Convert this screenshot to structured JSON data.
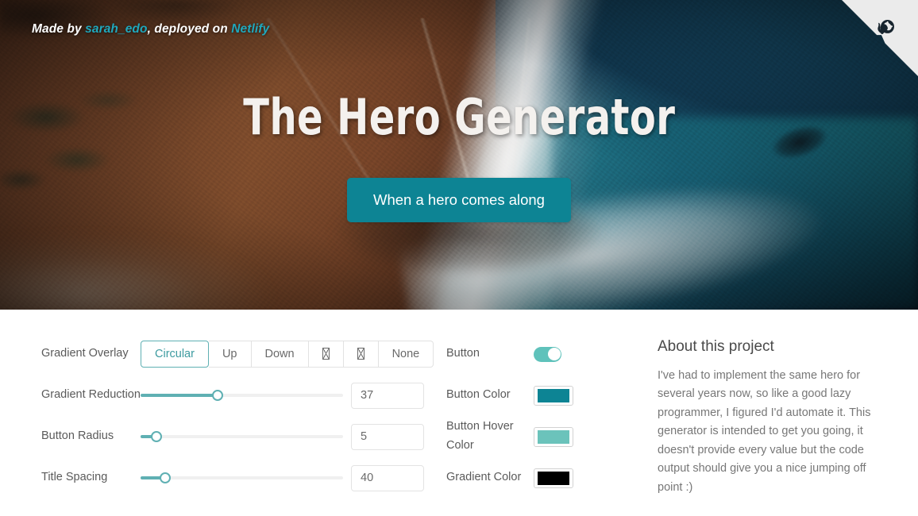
{
  "hero": {
    "credit_prefix": "Made by ",
    "credit_author": "sarah_edo",
    "credit_middle": ", deployed on ",
    "credit_host": "Netlify",
    "title": "The Hero Generator",
    "cta_label": "When a hero comes along",
    "cta_color": "#0d8494",
    "gradient_overlay_style": "Circular",
    "gradient_color": "#000000",
    "corner_ribbon_icon": "github-octocat-icon"
  },
  "controls": {
    "gradient_overlay": {
      "label": "Gradient Overlay",
      "options": [
        {
          "label": "Circular",
          "selected": true
        },
        {
          "label": "Up",
          "selected": false
        },
        {
          "label": "Down",
          "selected": false
        },
        {
          "label": "☒",
          "selected": false,
          "missing_glyph": true
        },
        {
          "label": "☒",
          "selected": false,
          "missing_glyph": true
        },
        {
          "label": "None",
          "selected": false
        }
      ]
    },
    "sliders": [
      {
        "label": "Gradient Reduction",
        "value": "37",
        "percent": 38
      },
      {
        "label": "Button Radius",
        "value": "5",
        "percent": 8
      },
      {
        "label": "Title Spacing",
        "value": "40",
        "percent": 12
      }
    ],
    "button_toggle": {
      "label": "Button",
      "on": true,
      "accent": "#5fc2bb"
    },
    "colors": [
      {
        "label": "Button Color",
        "value": "#0d8494"
      },
      {
        "label": "Button Hover Color",
        "value": "#6bc3bb"
      },
      {
        "label": "Gradient Color",
        "value": "#000000"
      }
    ]
  },
  "about": {
    "title": "About this project",
    "body": "I've had to implement the same hero for several years now, so like a good lazy programmer, I figured I'd automate it. This generator is intended to get you going, it doesn't provide every value but the code output should give you a nice jumping off point :)"
  }
}
